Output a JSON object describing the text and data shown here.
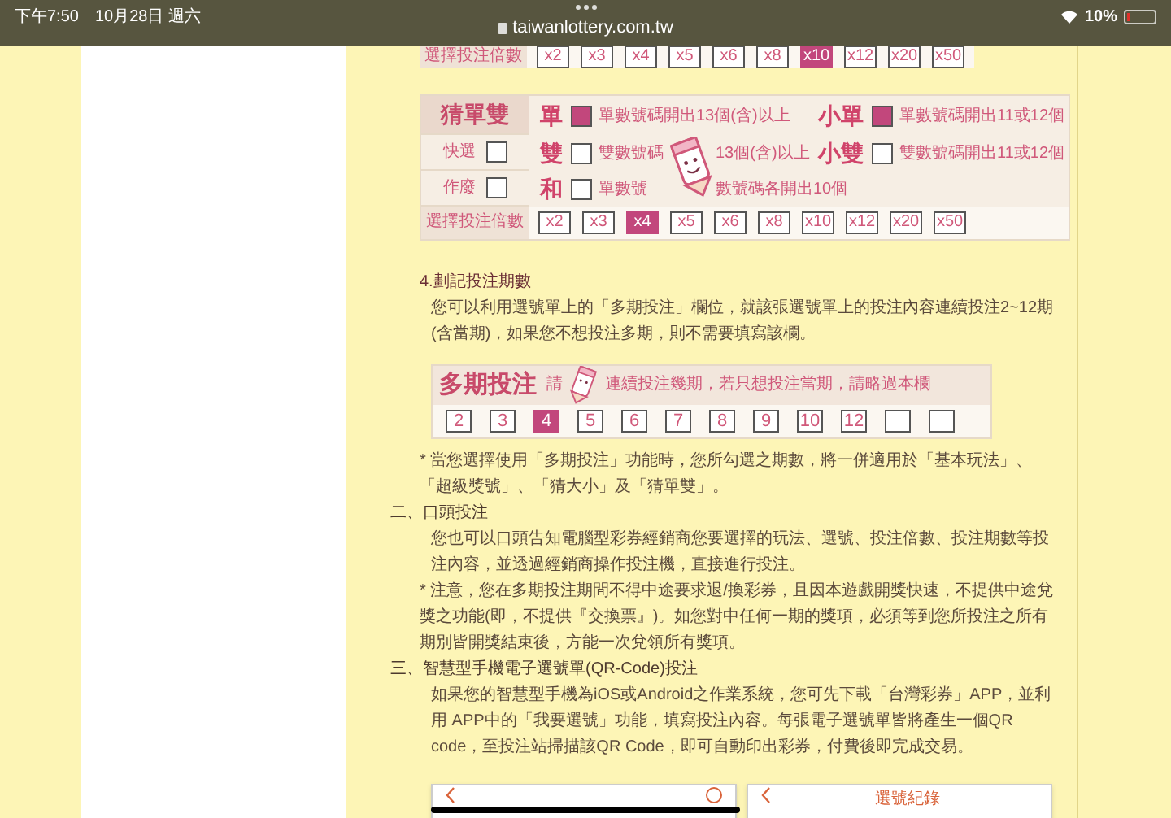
{
  "status_bar": {
    "time": "下午7:50",
    "date": "10月28日 週六",
    "url": "taiwanlottery.com.tw",
    "battery": "10%"
  },
  "top_multiplier_row": {
    "label": "選擇投注倍數",
    "options": [
      {
        "label": "x2",
        "selected": false
      },
      {
        "label": "x3",
        "selected": false
      },
      {
        "label": "x4",
        "selected": false
      },
      {
        "label": "x5",
        "selected": false
      },
      {
        "label": "x6",
        "selected": false
      },
      {
        "label": "x8",
        "selected": false
      },
      {
        "label": "x10",
        "selected": true
      },
      {
        "label": "x12",
        "selected": false
      },
      {
        "label": "x20",
        "selected": false
      },
      {
        "label": "x50",
        "selected": false
      }
    ]
  },
  "odd_even_ticket": {
    "title": "猜單雙",
    "side": [
      {
        "label": "快選",
        "checked": false
      },
      {
        "label": "作廢",
        "checked": false
      }
    ],
    "rows": [
      [
        {
          "label": "單",
          "desc": [
            "單數號碼開出13個(含)以上"
          ],
          "checked": true
        },
        {
          "label": "小單",
          "desc": [
            "單數號碼開出11或12個"
          ],
          "checked": true
        }
      ],
      [
        {
          "label": "雙",
          "desc": [
            "雙數號碼",
            "13個(含)以上"
          ],
          "checked": false
        },
        {
          "label": "小雙",
          "desc": [
            "雙數號碼開出11或12個"
          ],
          "checked": false
        }
      ],
      [
        {
          "label": "和",
          "desc": [
            "單數號",
            "數號碼各開出10個"
          ],
          "checked": false
        }
      ]
    ],
    "multiplier": {
      "label": "選擇投注倍數",
      "options": [
        {
          "label": "x2",
          "selected": false
        },
        {
          "label": "x3",
          "selected": false
        },
        {
          "label": "x4",
          "selected": true
        },
        {
          "label": "x5",
          "selected": false
        },
        {
          "label": "x6",
          "selected": false
        },
        {
          "label": "x8",
          "selected": false
        },
        {
          "label": "x10",
          "selected": false
        },
        {
          "label": "x12",
          "selected": false
        },
        {
          "label": "x20",
          "selected": false
        },
        {
          "label": "x50",
          "selected": false
        }
      ]
    }
  },
  "content": [
    {
      "kind": "subheading",
      "text": "4.劃記投注期數"
    },
    {
      "kind": "paragraph",
      "text": "您可以利用選號單上的「多期投注」欄位，就該張選號單上的投注內容連續投注2~12期(含當期)，如果您不想投注多期，則不需要填寫該欄。"
    },
    {
      "kind": "period_ticket",
      "title": "多期投注",
      "hint": [
        "請",
        "連續投注幾期，若只想投注當期，請略過本欄"
      ],
      "options": [
        {
          "label": "2",
          "selected": false
        },
        {
          "label": "3",
          "selected": false
        },
        {
          "label": "4",
          "selected": true
        },
        {
          "label": "5",
          "selected": false
        },
        {
          "label": "6",
          "selected": false
        },
        {
          "label": "7",
          "selected": false
        },
        {
          "label": "8",
          "selected": false
        },
        {
          "label": "9",
          "selected": false
        },
        {
          "label": "10",
          "selected": false
        },
        {
          "label": "12",
          "selected": false
        },
        {
          "selected": false
        },
        {
          "selected": false
        }
      ]
    },
    {
      "kind": "note",
      "text": "* 當您選擇使用「多期投注」功能時，您所勾選之期數，將一併適用於「基本玩法」、「超級獎號」、「猜大小」及「猜單雙」。"
    },
    {
      "kind": "section",
      "text": "二、口頭投注"
    },
    {
      "kind": "paragraph",
      "text": "您也可以口頭告知電腦型彩券經銷商您要選擇的玩法、選號、投注倍數、投注期數等投注內容，並透過經銷商操作投注機，直接進行投注。"
    },
    {
      "kind": "note",
      "text": "* 注意，您在多期投注期間不得中途要求退/換彩券，且因本遊戲開獎快速，不提供中途兌獎之功能(即，不提供『交換票』)。如您對中任何一期的獎項，必須等到您所投注之所有期別皆開獎結束後，方能一次兌領所有獎項。"
    },
    {
      "kind": "section",
      "text": "三、智慧型手機電子選號單(QR-Code)投注"
    },
    {
      "kind": "paragraph",
      "text": "如果您的智慧型手機為iOS或Android之作業系統，您可先下載「台灣彩券」APP，並利用 APP中的「我要選號」功能，填寫投注內容。每張電子選號單皆將產生一個QR code，至投注站掃描該QR Code，即可自動印出彩券，付費後即完成交易。"
    },
    {
      "kind": "app_cards",
      "cards": [
        {
          "help": true
        },
        {
          "title": "選號紀錄",
          "help": false
        }
      ]
    }
  ]
}
